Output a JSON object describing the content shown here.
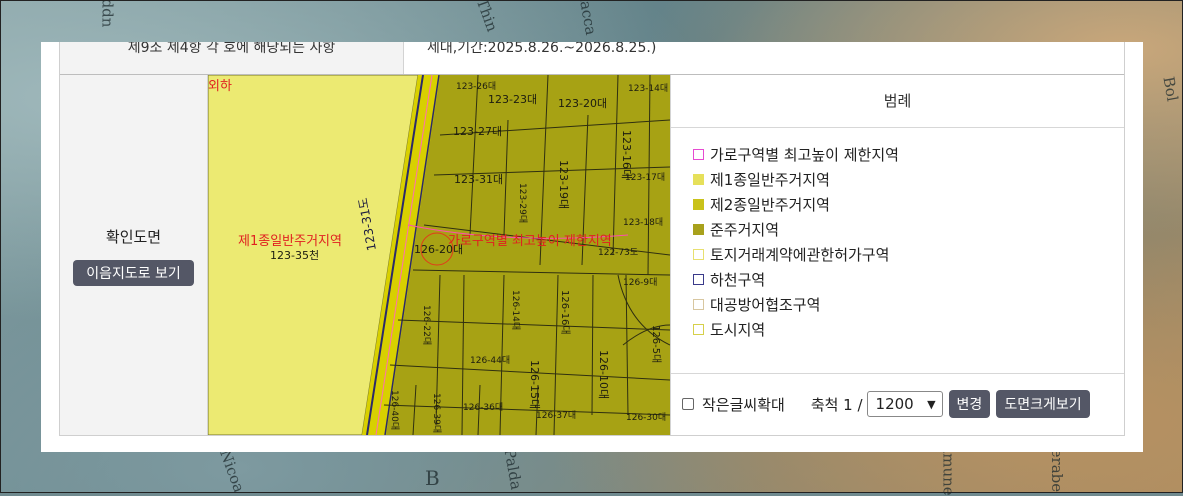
{
  "background": {
    "map_labels": [
      "ddn",
      "Thin",
      "Lacca",
      "Nicoa",
      "B",
      "Palda",
      "Bol",
      "Kerabe",
      "Jamune"
    ]
  },
  "row_top": {
    "header": "제9조 제4항 각 호에 해당되는 사항",
    "value": "세대,기간:2025.8.26.~2026.8.25.)"
  },
  "confirm": {
    "label": "확인도면",
    "button": "이음지도로 보기"
  },
  "map": {
    "zone_label_left": "제1종일반주거지역",
    "parcel_left": "123-35천",
    "top_left_text": "외하",
    "road_label": "123-31도",
    "limit_zone_label": "가로구역별 최고높이 제한지역",
    "parcels": [
      "123-26대",
      "123-23대",
      "123-20대",
      "123-14대",
      "123-27대",
      "123-16대",
      "123-19대",
      "123-31대",
      "123-29대",
      "123-17대",
      "126-20대",
      "123-18대",
      "126-22대",
      "122-73도",
      "126-14대",
      "126-9대",
      "126-16대",
      "126-5대",
      "126-15대",
      "126-10대",
      "126-44대",
      "126-37대",
      "126-30대",
      "126-40대",
      "126-39대",
      "126-36대"
    ]
  },
  "legend": {
    "title": "범례",
    "items": [
      {
        "label": "가로구역별 최고높이 제한지역",
        "border": "#e64bd1",
        "fill": "#ffffff"
      },
      {
        "label": "제1종일반주거지역",
        "border": "#e6e05a",
        "fill": "#e6e05a"
      },
      {
        "label": "제2종일반주거지역",
        "border": "#c9c21a",
        "fill": "#c9c21a"
      },
      {
        "label": "준주거지역",
        "border": "#a8a11c",
        "fill": "#a8a11c"
      },
      {
        "label": "토지거래계약에관한허가구역",
        "border": "#e8e070",
        "fill": "#ffffff"
      },
      {
        "label": "하천구역",
        "border": "#3a3a8a",
        "fill": "#ffffff"
      },
      {
        "label": "대공방어협조구역",
        "border": "#d8c7a0",
        "fill": "#ffffff"
      },
      {
        "label": "도시지역",
        "border": "#d6d04a",
        "fill": "#ffffff"
      }
    ]
  },
  "footer": {
    "small_text": "작은글씨확대",
    "scale_prefix": "축척 1 /",
    "scale_value": "1200",
    "change_button": "변경",
    "enlarge_button": "도면크게보기"
  }
}
